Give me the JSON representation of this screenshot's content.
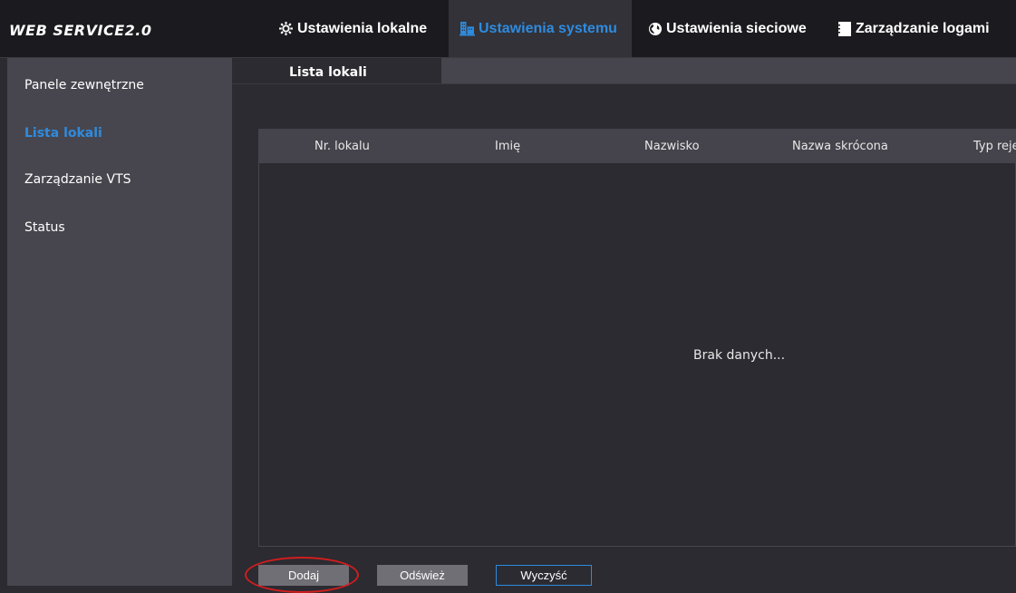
{
  "header": {
    "logo": "WEB SERVICE2.0",
    "nav": [
      {
        "label": "Ustawienia lokalne",
        "icon": "gear-icon"
      },
      {
        "label": "Ustawienia systemu",
        "icon": "building-icon",
        "active": true
      },
      {
        "label": "Ustawienia sieciowe",
        "icon": "globe-icon"
      },
      {
        "label": "Zarządzanie logami",
        "icon": "log-icon"
      }
    ]
  },
  "sidebar": {
    "items": [
      {
        "label": "Panele zewnętrzne"
      },
      {
        "label": "Lista lokali",
        "active": true
      },
      {
        "label": "Zarządzanie VTS"
      },
      {
        "label": "Status"
      }
    ]
  },
  "main": {
    "tab_label": "Lista lokali",
    "table": {
      "columns": [
        "Nr. lokalu",
        "Imię",
        "Nazwisko",
        "Nazwa skrócona",
        "Typ rejes"
      ],
      "empty_text": "Brak danych..."
    },
    "buttons": {
      "add": "Dodaj",
      "refresh": "Odśwież",
      "clear": "Wyczyść"
    }
  },
  "colors": {
    "accent": "#2f8bde",
    "highlight": "#d21d1d"
  }
}
